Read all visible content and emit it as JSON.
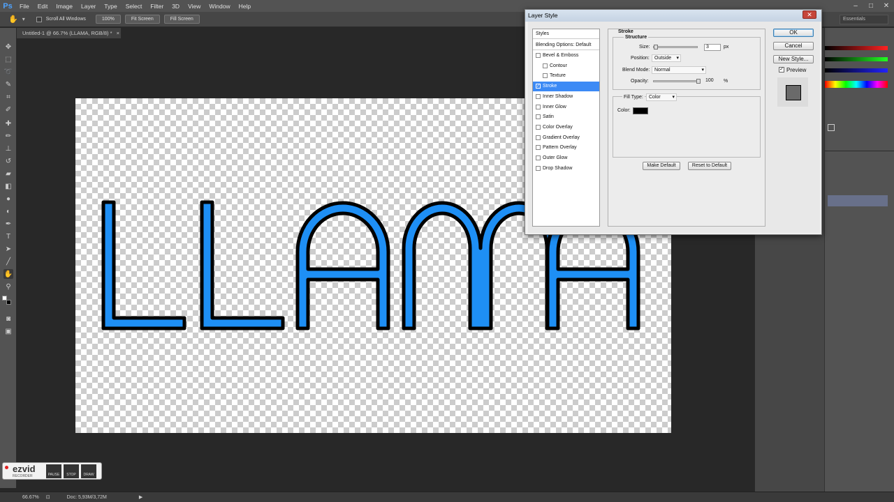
{
  "app": {
    "logo": "Ps"
  },
  "menu": [
    "File",
    "Edit",
    "Image",
    "Layer",
    "Type",
    "Select",
    "Filter",
    "3D",
    "View",
    "Window",
    "Help"
  ],
  "options_bar": {
    "scroll_all_windows": "Scroll All Windows",
    "zoom_button": "100%",
    "fit_screen": "Fit Screen",
    "fill_screen": "Fill Screen",
    "workspace": "Essentials"
  },
  "document": {
    "tab_title": "Untitled-1 @ 66.7% (LLAMA, RGB/8) *",
    "text": "LLAMA",
    "fill_color": "#1e8ff5",
    "stroke_color": "#000000"
  },
  "status": {
    "zoom": "66.67%",
    "doc": "Doc: 5,93M/3,72M"
  },
  "ezvid": {
    "logo": "ezvid",
    "sub": "RECORDER",
    "pause": "PAUSE",
    "stop": "STOP",
    "draw": "DRAW"
  },
  "dialog": {
    "title": "Layer Style",
    "styles_header": "Styles",
    "blending": "Blending Options: Default",
    "items": [
      {
        "label": "Bevel & Emboss",
        "checked": false,
        "sub": false,
        "selected": false
      },
      {
        "label": "Contour",
        "checked": false,
        "sub": true,
        "selected": false
      },
      {
        "label": "Texture",
        "checked": false,
        "sub": true,
        "selected": false
      },
      {
        "label": "Stroke",
        "checked": true,
        "sub": false,
        "selected": true
      },
      {
        "label": "Inner Shadow",
        "checked": false,
        "sub": false,
        "selected": false
      },
      {
        "label": "Inner Glow",
        "checked": false,
        "sub": false,
        "selected": false
      },
      {
        "label": "Satin",
        "checked": false,
        "sub": false,
        "selected": false
      },
      {
        "label": "Color Overlay",
        "checked": false,
        "sub": false,
        "selected": false
      },
      {
        "label": "Gradient Overlay",
        "checked": false,
        "sub": false,
        "selected": false
      },
      {
        "label": "Pattern Overlay",
        "checked": false,
        "sub": false,
        "selected": false
      },
      {
        "label": "Outer Glow",
        "checked": false,
        "sub": false,
        "selected": false
      },
      {
        "label": "Drop Shadow",
        "checked": false,
        "sub": false,
        "selected": false
      }
    ],
    "stroke": {
      "heading": "Stroke",
      "structure": "Structure",
      "size_label": "Size:",
      "size_value": "3",
      "size_unit": "px",
      "position_label": "Position:",
      "position_value": "Outside",
      "blend_label": "Blend Mode:",
      "blend_value": "Normal",
      "opacity_label": "Opacity:",
      "opacity_value": "100",
      "opacity_unit": "%",
      "fill_type_label": "Fill Type:",
      "fill_type_value": "Color",
      "color_label": "Color:",
      "color_value": "#000000",
      "make_default": "Make Default",
      "reset_default": "Reset to Default"
    },
    "buttons": {
      "ok": "OK",
      "cancel": "Cancel",
      "new_style": "New Style...",
      "preview": "Preview"
    }
  }
}
